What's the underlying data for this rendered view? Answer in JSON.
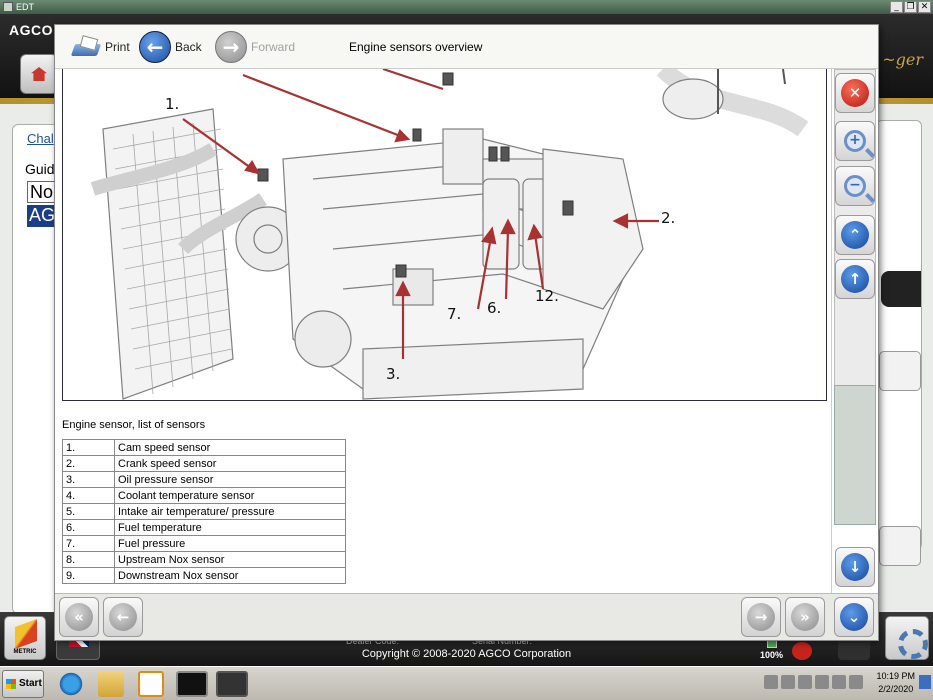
{
  "app": {
    "window_title": "EDT",
    "brand_left": "AGCO",
    "copyright": "Copyright © 2008-2020 AGCO Corporation",
    "dealer_label": "Dealer Code:",
    "serial_label": "Serial Number:",
    "bg_tab": "Chal",
    "bg_guide": "Guid",
    "bg_option_1": "No",
    "bg_option_2": "AG",
    "metric_label": "METRIC",
    "battery": "100%",
    "win_ctrls": [
      "_",
      "❐",
      "✕"
    ]
  },
  "taskbar": {
    "start_label": "Start",
    "time": "10:19 PM",
    "date": "2/2/2020"
  },
  "help_window": {
    "title": "Engine sensors overview",
    "toolbar": {
      "print_label": "Print",
      "back_label": "Back",
      "forward_label": "Forward"
    },
    "diagram_callouts": [
      "1.",
      "2.",
      "3.",
      "7.",
      "6.",
      "12."
    ],
    "list_caption": "Engine sensor, list of sensors",
    "sensors": [
      {
        "num": "1.",
        "name": "Cam speed sensor"
      },
      {
        "num": "2.",
        "name": "Crank speed sensor"
      },
      {
        "num": "3.",
        "name": "Oil pressure sensor"
      },
      {
        "num": "4.",
        "name": "Coolant temperature sensor"
      },
      {
        "num": "5.",
        "name": "Intake air temperature/ pressure"
      },
      {
        "num": "6.",
        "name": "Fuel temperature"
      },
      {
        "num": "7.",
        "name": "Fuel pressure"
      },
      {
        "num": "8.",
        "name": "Upstream Nox sensor"
      },
      {
        "num": "9.",
        "name": "Downstream Nox sensor"
      }
    ]
  },
  "colors": {
    "accent_blue": "#1b4fa3",
    "close_red": "#b3170c",
    "arrow_red": "#a83232",
    "gold": "#c9a44a"
  },
  "icons": {
    "close": "close-icon",
    "zoom_in": "zoom-in-icon",
    "zoom_out": "zoom-out-icon",
    "page_up": "double-chevron-up-icon",
    "scroll_up": "arrow-up-icon",
    "scroll_down": "arrow-down-icon",
    "page_down": "double-chevron-down-icon"
  }
}
